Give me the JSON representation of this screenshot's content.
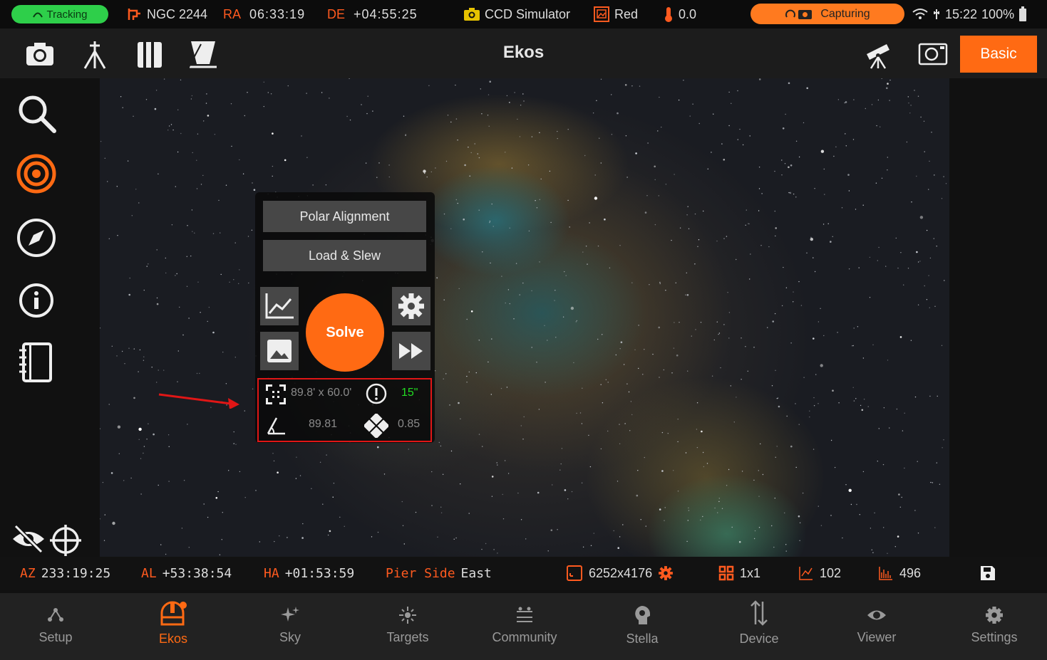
{
  "status_bar": {
    "tracking": "Tracking",
    "target": "NGC 2244",
    "ra_label": "RA",
    "ra_value": "06:33:19",
    "de_label": "DE",
    "de_value": "+04:55:25",
    "camera": "CCD Simulator",
    "filter": "Red",
    "temperature": "0.0",
    "capture_status": "Capturing",
    "time": "15:22",
    "battery": "100%"
  },
  "toolbar": {
    "title": "Ekos",
    "mode_button": "Basic"
  },
  "solve_panel": {
    "polar_alignment": "Polar Alignment",
    "load_slew": "Load & Slew",
    "solve": "Solve",
    "fov": "89.8' x 60.0'",
    "accuracy": "15\"",
    "rotation": "89.81",
    "pixscale": "0.85"
  },
  "info_bar": {
    "az_label": "AZ",
    "az_value": "233:19:25",
    "al_label": "AL",
    "al_value": "+53:38:54",
    "ha_label": "HA",
    "ha_value": "+01:53:59",
    "pier_label": "Pier Side",
    "pier_value": "East",
    "resolution": "6252x4176",
    "binning": "1x1",
    "exposure_stat": "102",
    "histogram_stat": "496"
  },
  "nav": [
    {
      "label": "Setup"
    },
    {
      "label": "Ekos"
    },
    {
      "label": "Sky"
    },
    {
      "label": "Targets"
    },
    {
      "label": "Community"
    },
    {
      "label": "Stella"
    },
    {
      "label": "Device"
    },
    {
      "label": "Viewer"
    },
    {
      "label": "Settings"
    }
  ],
  "colors": {
    "accent": "#ff6a13",
    "tracking_green": "#2ecf4a",
    "highlight_red": "#e01616",
    "good_green": "#22dd22"
  }
}
